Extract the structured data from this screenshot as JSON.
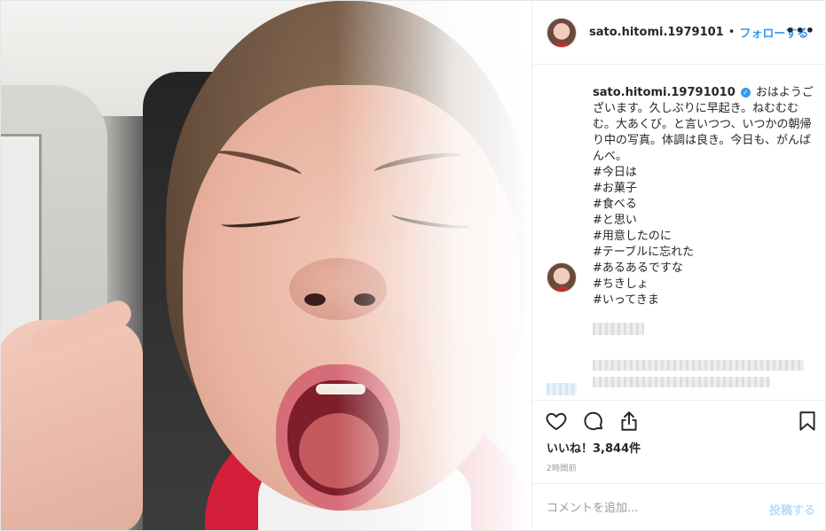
{
  "header": {
    "username": "sato.hitomi.1979101",
    "separator": "•",
    "follow_label": "フォローする",
    "more_label": "•••"
  },
  "caption": {
    "username": "sato.hitomi.19791010",
    "verified_mark": "✓",
    "text": "おはようございます。久しぶりに早起き。ねむむむむ。大あくび。と言いつつ、いつかの朝帰り中の写真。体調は良き。今日も、がんばんべ。",
    "hashtags": [
      "#今日は",
      "#お菓子",
      "#食べる",
      "#と思い",
      "#用意したのに",
      "#テーブルに忘れた",
      "#あるあるですな",
      "#ちきしょ",
      "#いってきま"
    ]
  },
  "icons": {
    "like": "heart-icon",
    "comment": "comment-bubble-icon",
    "share": "share-icon",
    "save": "bookmark-icon"
  },
  "likes_label": "いいね！3,844件",
  "timestamp": "2時間前",
  "comment_box": {
    "placeholder": "コメントを追加...",
    "post_label": "投稿する"
  },
  "colors": {
    "link_blue": "#3897f0",
    "post_disabled": "#b2dffc",
    "text": "#262626",
    "muted": "#999999",
    "border": "#efefef"
  }
}
